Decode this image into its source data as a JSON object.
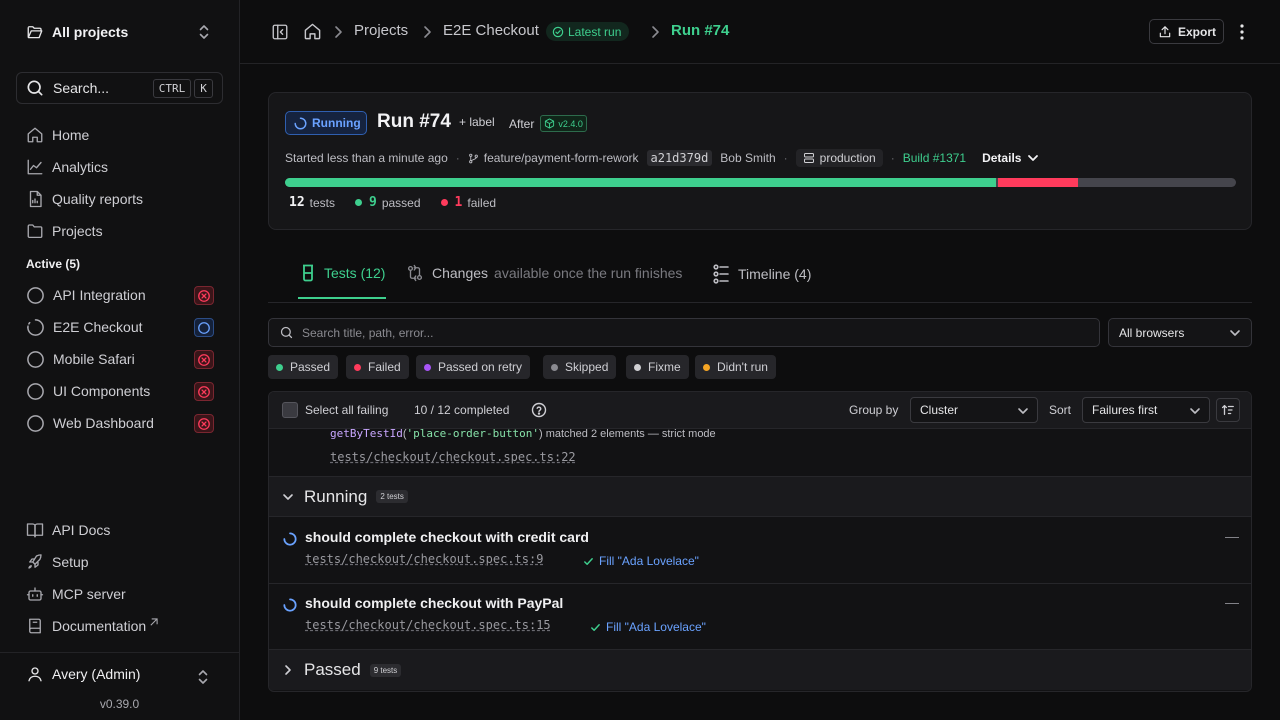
{
  "sidebar": {
    "project_switcher": "All projects",
    "search": {
      "label": "Search...",
      "kbd_ctrl": "CTRL",
      "kbd_k": "K"
    },
    "nav": [
      {
        "label": "Home",
        "icon": "home-icon"
      },
      {
        "label": "Analytics",
        "icon": "chart-line-icon"
      },
      {
        "label": "Quality reports",
        "icon": "report-icon"
      },
      {
        "label": "Projects",
        "icon": "folder-icon"
      }
    ],
    "active_title": "Active (5)",
    "active": [
      {
        "label": "API Integration",
        "status": "failed"
      },
      {
        "label": "E2E Checkout",
        "status": "running"
      },
      {
        "label": "Mobile Safari",
        "status": "failed"
      },
      {
        "label": "UI Components",
        "status": "failed"
      },
      {
        "label": "Web Dashboard",
        "status": "failed"
      }
    ],
    "bottom_nav": [
      {
        "label": "API Docs",
        "icon": "book-icon"
      },
      {
        "label": "Setup",
        "icon": "rocket-icon"
      },
      {
        "label": "MCP server",
        "icon": "bot-icon"
      },
      {
        "label": "Documentation",
        "icon": "docs-icon"
      }
    ],
    "user": "Avery (Admin)",
    "version": "v0.39.0"
  },
  "topbar": {
    "crumbs": [
      "Projects",
      "E2E Checkout"
    ],
    "latest_badge": "Latest run",
    "run_crumb": "Run #74",
    "export_label": "Export"
  },
  "run": {
    "status": "Running",
    "title": "Run #74",
    "add_label": "+ label",
    "after_label": "After",
    "version_chip": "v2.4.0",
    "started": "Started less than a minute ago",
    "branch": "feature/payment-form-rework",
    "sha": "a21d379d",
    "author": "Bob Smith",
    "environment": "production",
    "build": "Build #1371",
    "details_label": "Details",
    "progress": {
      "total": 12,
      "passed": 9,
      "failed": 1
    },
    "counts": {
      "tests": "12",
      "tests_label": "tests",
      "passed": "9",
      "passed_label": "passed",
      "failed": "1",
      "failed_label": "failed"
    }
  },
  "tabs": {
    "tests": "Tests (12)",
    "changes": "Changes",
    "changes_note": "available once the run finishes",
    "timeline": "Timeline (4)"
  },
  "filters": {
    "search_placeholder": "Search title, path, error...",
    "browser": "All browsers",
    "chips": [
      {
        "label": "Passed",
        "color": "#3ecf8e"
      },
      {
        "label": "Failed",
        "color": "#ff3b5c"
      },
      {
        "label": "Passed on retry",
        "color": "#a855f7"
      },
      {
        "label": "Skipped",
        "color": "#8a8a90"
      },
      {
        "label": "Fixme",
        "color": "#d0d0d4"
      },
      {
        "label": "Didn't run",
        "color": "#f5a524"
      }
    ]
  },
  "results": {
    "select_all": "Select all failing",
    "completed": "10 / 12 completed",
    "group_by_label": "Group by",
    "group_by": "Cluster",
    "sort_label": "Sort",
    "sort": "Failures first",
    "error": {
      "fn": "getByTestId",
      "paren_open": "(",
      "arg": "'place-order-button'",
      "paren_close": ")",
      "message": " matched 2 elements — strict mode",
      "path": "tests/checkout/checkout.spec.ts:22"
    },
    "running_group": {
      "title": "Running",
      "count": "2 tests"
    },
    "tests": [
      {
        "name": "should complete checkout with credit card",
        "path": "tests/checkout/checkout.spec.ts:9",
        "step": "Fill \"Ada Lovelace\"",
        "duration": "—"
      },
      {
        "name": "should complete checkout with PayPal",
        "path": "tests/checkout/checkout.spec.ts:15",
        "step": "Fill \"Ada Lovelace\"",
        "duration": "—"
      }
    ],
    "passed_group": {
      "title": "Passed",
      "count": "9 tests"
    }
  },
  "colors": {
    "accent": "#3ecf8e",
    "danger": "#ff3b5c",
    "running": "#6aa2ff"
  }
}
